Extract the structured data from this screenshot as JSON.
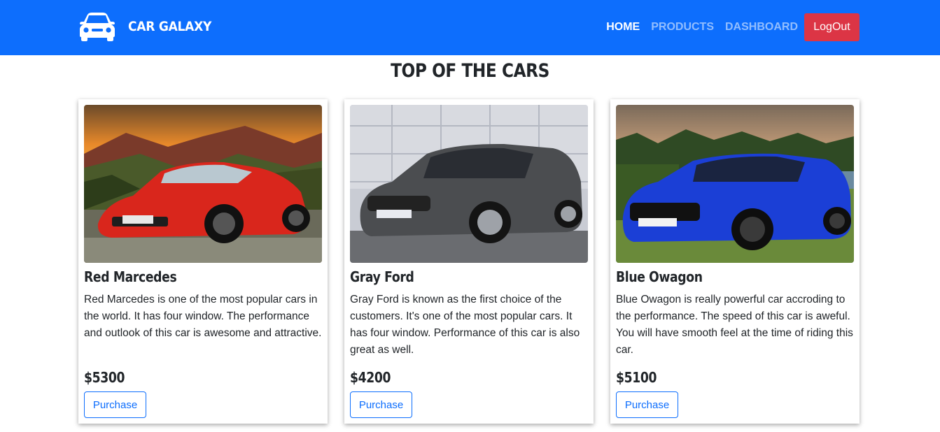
{
  "brand": {
    "name": "CAR GALAXY",
    "icon": "car-icon"
  },
  "nav": {
    "home": "HOME",
    "products": "PRODUCTS",
    "dashboard": "DASHBOARD",
    "logout": "LogOut"
  },
  "page": {
    "title": "TOP OF THE CARS"
  },
  "cards": [
    {
      "title": "Red Marcedes",
      "description": "Red Marcedes is one of the most popular cars in the world. It has four window. The performance and outlook of this car is awesome and attractive.",
      "price": "$5300",
      "button": "Purchase"
    },
    {
      "title": "Gray Ford",
      "description": "Gray Ford is known as the first choice of the customers. It's one of the most popular cars. It has four window. Performance of this car is also great as well.",
      "price": "$4200",
      "button": "Purchase"
    },
    {
      "title": "Blue Owagon",
      "description": "Blue Owagon is really powerful car accroding to the performance. The speed of this car is aweful. You will have smooth feel at the time of riding this car.",
      "price": "$5100",
      "button": "Purchase"
    }
  ],
  "colors": {
    "navbar": "#0d6efd",
    "logout": "#dc3545",
    "accent": "#0d6efd",
    "text": "#212529"
  }
}
